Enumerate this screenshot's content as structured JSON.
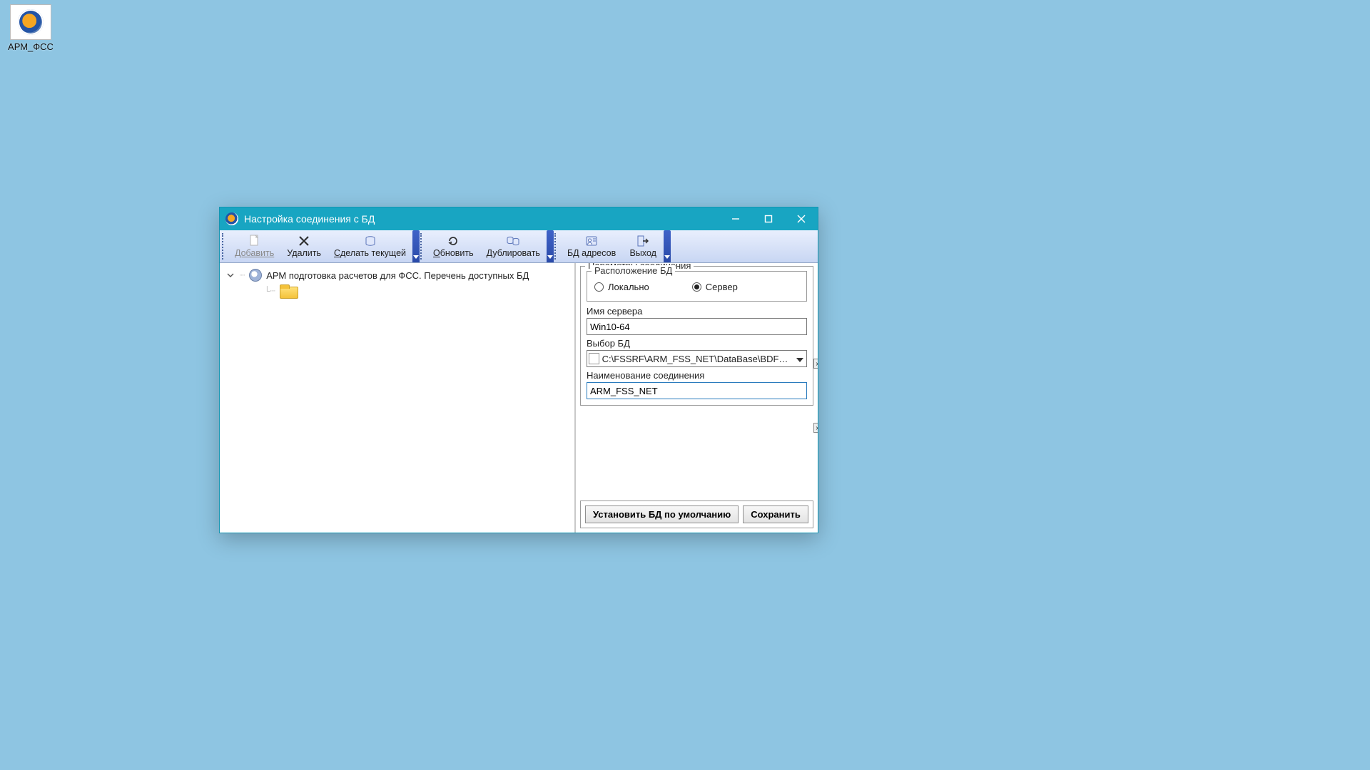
{
  "desktop": {
    "icon_label": "АРМ_ФСС"
  },
  "window": {
    "title": "Настройка соединения с БД"
  },
  "toolbar": {
    "add": "Добавить",
    "delete": "Удалить",
    "make_current": "Сделать текущей",
    "refresh": "Обновить",
    "duplicate": "Дублировать",
    "addr_db": "БД адресов",
    "exit": "Выход"
  },
  "tree": {
    "root": "АРМ подготовка расчетов для ФСС. Перечень доступных БД"
  },
  "params": {
    "legend": "Параметры соединения",
    "location_legend": "Расположение БД",
    "radio_local": "Локально",
    "radio_server": "Сервер",
    "server_label": "Имя сервера",
    "server_value": "Win10-64",
    "db_select_label": "Выбор БД",
    "db_path": "C:\\FSSRF\\ARM_FSS_NET\\DataBase\\BDFSS.FDB",
    "conn_name_label": "Наименование соединения",
    "conn_name_value": "ARM_FSS_NET"
  },
  "buttons": {
    "set_default": "Установить БД по умолчанию",
    "save": "Сохранить"
  }
}
